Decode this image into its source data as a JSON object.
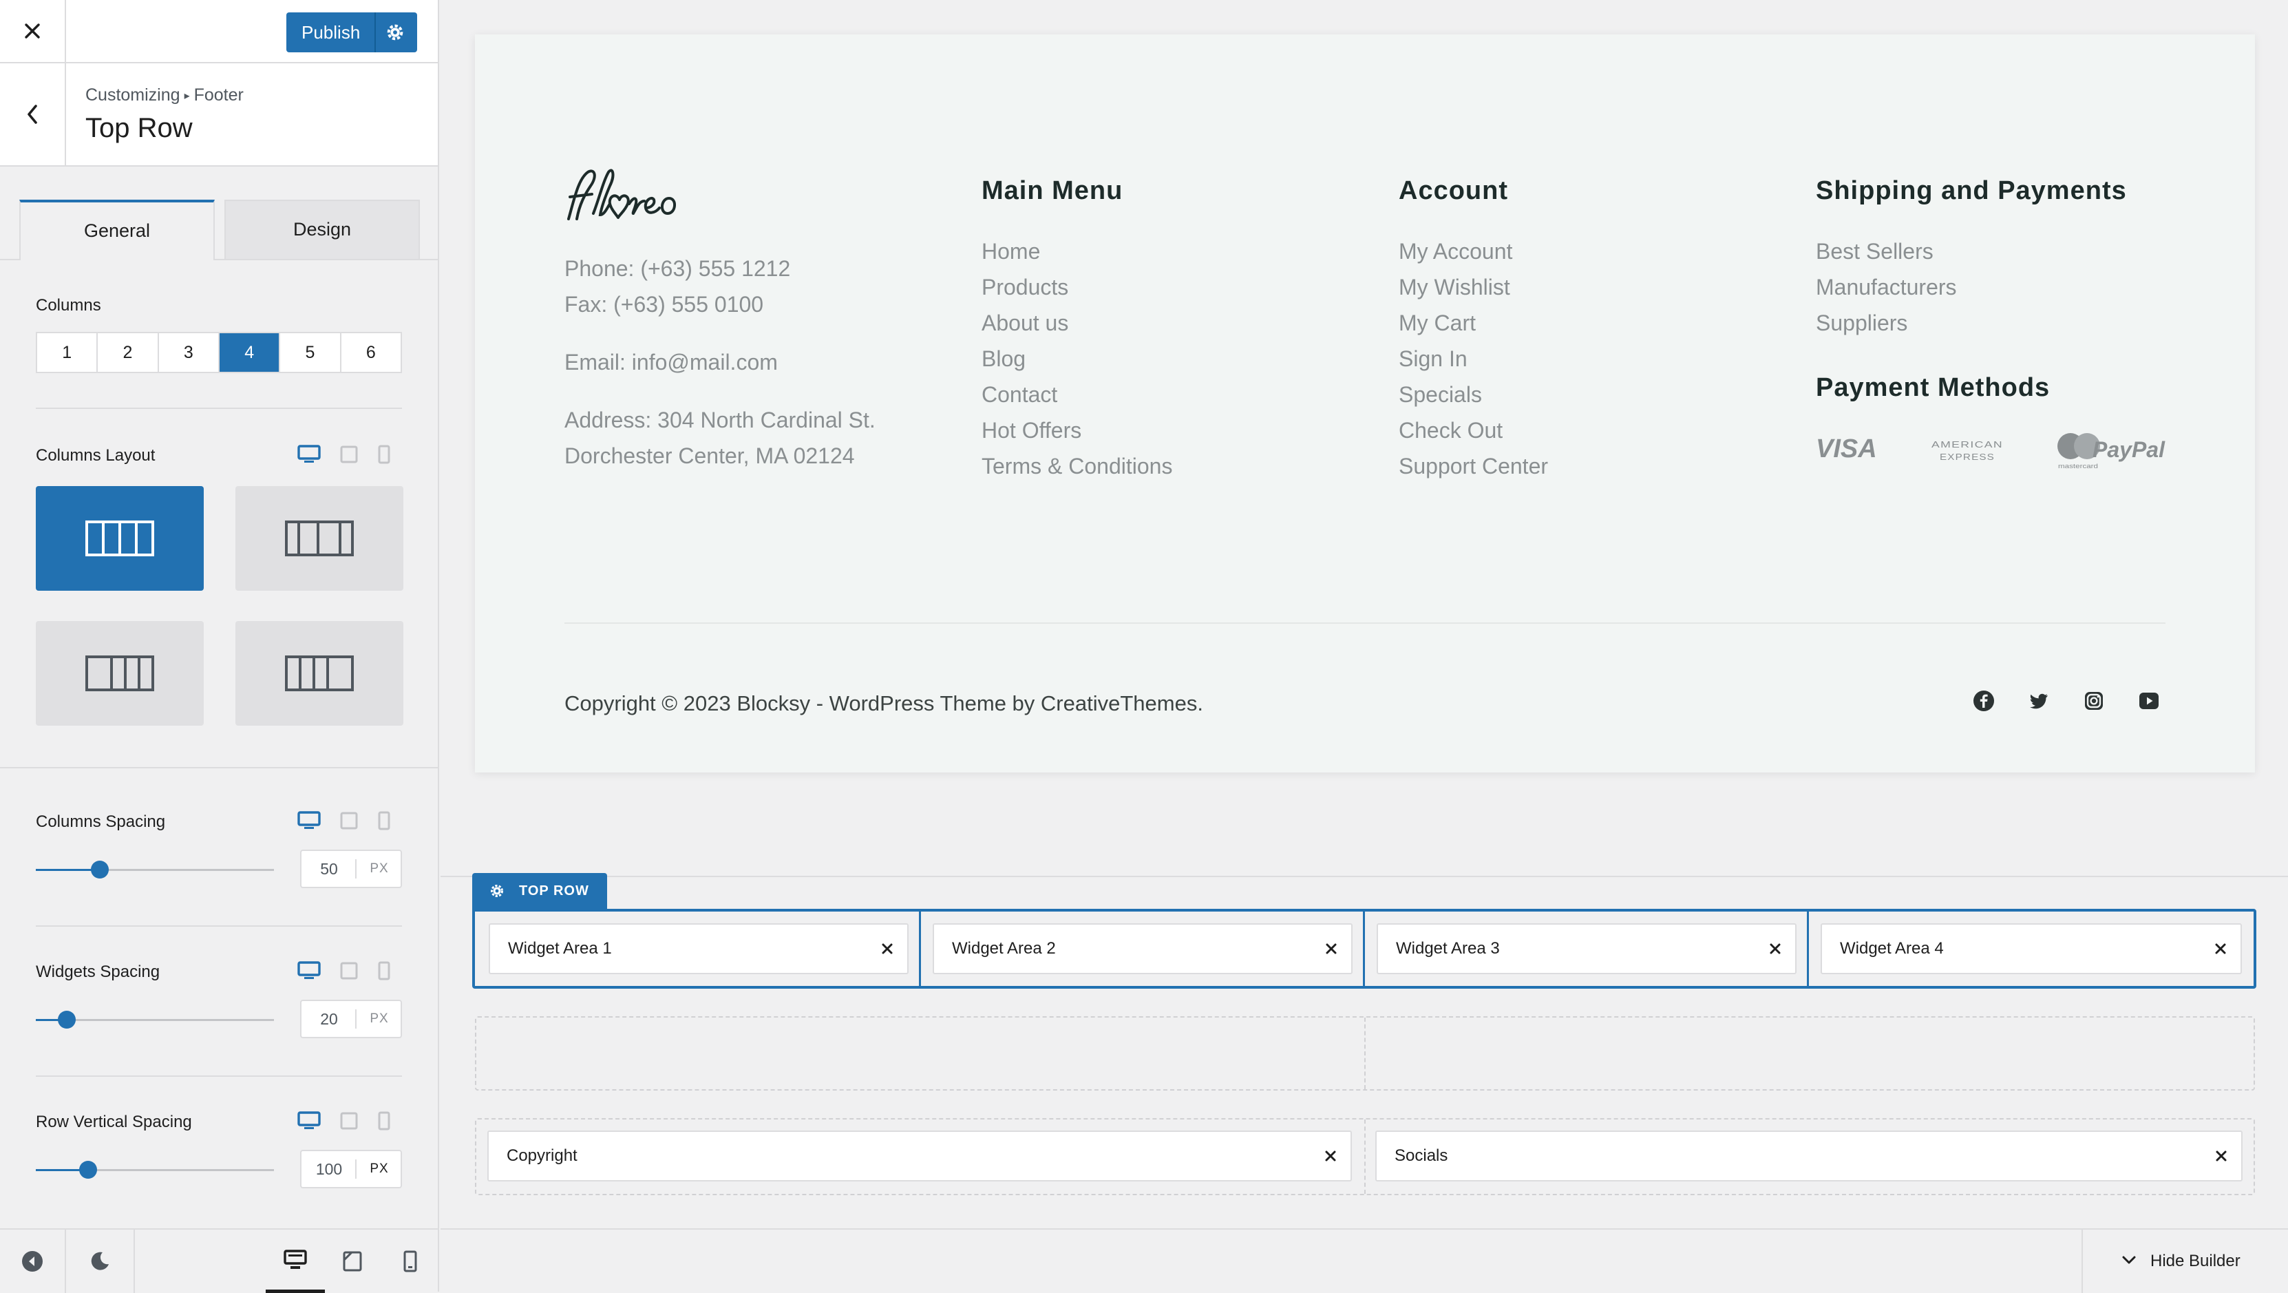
{
  "colors": {
    "accent": "#2271b1",
    "panel_bg": "#f0f0f1",
    "preview_bg": "#f2f5f4"
  },
  "header": {
    "close_icon": "close-icon",
    "publish_label": "Publish",
    "publish_settings_icon": "gear-icon"
  },
  "panel": {
    "breadcrumb_root": "Customizing",
    "breadcrumb_separator": "▸",
    "breadcrumb_section": "Footer",
    "title": "Top Row",
    "tabs": [
      {
        "label": "General",
        "active": true
      },
      {
        "label": "Design",
        "active": false
      }
    ],
    "columns_label": "Columns",
    "columns_options": [
      "1",
      "2",
      "3",
      "4",
      "5",
      "6"
    ],
    "columns_selected": "4",
    "columns_layout_label": "Columns Layout",
    "columns_layout_selected_index": 0,
    "sliders": [
      {
        "label": "Columns Spacing",
        "value": "50",
        "unit": "PX",
        "fill_fraction": 0.27
      },
      {
        "label": "Widgets Spacing",
        "value": "20",
        "unit": "PX",
        "fill_fraction": 0.13
      },
      {
        "label": "Row Vertical Spacing",
        "value": "100",
        "unit": "PX",
        "fill_fraction": 0.22
      }
    ]
  },
  "sidebar_footer": {
    "icons": [
      "collapse-icon",
      "dark-mode-icon",
      "desktop-icon",
      "tablet-icon",
      "mobile-icon"
    ],
    "active_device": "desktop"
  },
  "preview": {
    "logo_text": "floreo",
    "phone": "Phone: (+63) 555 1212",
    "fax": "Fax: (+63) 555 0100",
    "email": "Email: info@mail.com",
    "address_line1": "Address: 304 North Cardinal St.",
    "address_line2": "Dorchester Center, MA 02124",
    "main_menu": {
      "title": "Main Menu",
      "items": [
        "Home",
        "Products",
        "About us",
        "Blog",
        "Contact",
        "Hot Offers",
        "Terms & Conditions"
      ]
    },
    "account": {
      "title": "Account",
      "items": [
        "My Account",
        "My Wishlist",
        "My Cart",
        "Sign In",
        "Specials",
        "Check Out",
        "Support Center"
      ]
    },
    "shipping": {
      "title": "Shipping and Payments",
      "items": [
        "Best Sellers",
        "Manufacturers",
        "Suppliers"
      ]
    },
    "payment_title": "Payment Methods",
    "payment_methods": [
      "VISA",
      "AMERICAN EXPRESS",
      "mastercard",
      "PayPal"
    ],
    "copyright": "Copyright © 2023 Blocksy - WordPress Theme by CreativeThemes.",
    "socials": [
      "facebook-icon",
      "twitter-icon",
      "instagram-icon",
      "youtube-icon"
    ]
  },
  "builder": {
    "top_row_label": "TOP ROW",
    "top_row_widgets": [
      "Widget Area 1",
      "Widget Area 2",
      "Widget Area 3",
      "Widget Area 4"
    ],
    "bottom_row_widgets": [
      "Copyright",
      "Socials"
    ],
    "hide_builder_label": "Hide Builder"
  }
}
